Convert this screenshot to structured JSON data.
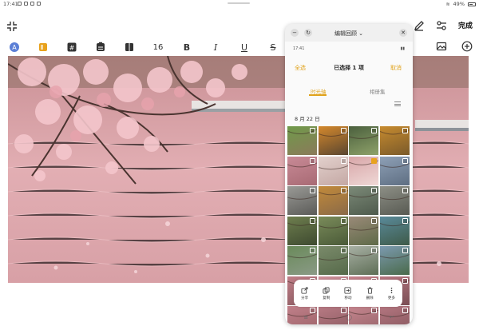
{
  "status_bar": {
    "time": "17:41",
    "battery": "49%"
  },
  "toolbar": {
    "done_label": "完成"
  },
  "format_bar": {
    "font_size": "16",
    "bold": "B",
    "italic": "I",
    "underline": "U",
    "strike": "S"
  },
  "panel": {
    "title": "编辑回顾",
    "status_time": "17:41",
    "select_all": "全选",
    "selected_count": "已选择 1 项",
    "cancel": "取消",
    "tabs": [
      "时光轴",
      "相册集"
    ],
    "date": "8 月 22 日",
    "actions": [
      "分享",
      "复制",
      "移动",
      "删除",
      "更多"
    ]
  },
  "colors": {
    "accent": "#e0a21b",
    "check_selected": "#e8a21d"
  },
  "thumbnails": [
    {
      "c1": "#6f9a4a",
      "c2": "#8b7a5a",
      "checked": false
    },
    {
      "c1": "#d4882c",
      "c2": "#5a4630",
      "checked": false
    },
    {
      "c1": "#4a5f3d",
      "c2": "#8fa26a",
      "checked": false
    },
    {
      "c1": "#c78b2f",
      "c2": "#7a5a2a",
      "checked": false
    },
    {
      "c1": "#c88a96",
      "c2": "#a86a74",
      "checked": false
    },
    {
      "c1": "#e2d0cc",
      "c2": "#c4a8a4",
      "checked": false
    },
    {
      "c1": "#d8a6a8",
      "c2": "#efd8d6",
      "checked": true
    },
    {
      "c1": "#8ea0b6",
      "c2": "#5e6e82",
      "checked": false
    },
    {
      "c1": "#9a9a96",
      "c2": "#5b5b58",
      "checked": false
    },
    {
      "c1": "#c28a3a",
      "c2": "#8a6a48",
      "checked": false
    },
    {
      "c1": "#7c8a78",
      "c2": "#4e5a4c",
      "checked": false
    },
    {
      "c1": "#8d8f86",
      "c2": "#585a52",
      "checked": false
    },
    {
      "c1": "#6e7e4e",
      "c2": "#3e4a30",
      "checked": false
    },
    {
      "c1": "#7a8b5a",
      "c2": "#4a5a38",
      "checked": false
    },
    {
      "c1": "#9a8a78",
      "c2": "#5e6a48",
      "checked": false
    },
    {
      "c1": "#5a8a9a",
      "c2": "#3e5a48",
      "checked": false
    },
    {
      "c1": "#6a8a5a",
      "c2": "#8a9a86",
      "checked": false
    },
    {
      "c1": "#7a8a6a",
      "c2": "#566a4a",
      "checked": false
    },
    {
      "c1": "#a8b0a4",
      "c2": "#5e6e56",
      "checked": false
    },
    {
      "c1": "#7c9ab0",
      "c2": "#4a6a4a",
      "checked": false
    },
    {
      "c1": "#c07e88",
      "c2": "#8a5a60",
      "checked": false
    },
    {
      "c1": "#d0909a",
      "c2": "#9a6a70",
      "checked": false
    },
    {
      "c1": "#c8848e",
      "c2": "#8e5e64",
      "checked": false
    },
    {
      "c1": "#b87882",
      "c2": "#7a4e54",
      "checked": false
    },
    {
      "c1": "#c0808a",
      "c2": "#9a6066",
      "checked": false
    },
    {
      "c1": "#b87a84",
      "c2": "#8a5a60",
      "checked": false
    },
    {
      "c1": "#c6868f",
      "c2": "#946268",
      "checked": false
    },
    {
      "c1": "#b47680",
      "c2": "#84565c",
      "checked": false
    }
  ]
}
